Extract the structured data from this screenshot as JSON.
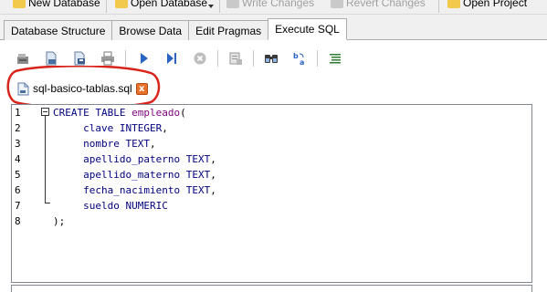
{
  "top_toolbar": {
    "items": [
      {
        "label": "New Database",
        "icon": "new-database-icon",
        "enabled": true
      },
      {
        "label": "Open Database",
        "icon": "open-database-icon",
        "enabled": true
      },
      {
        "label": "Write Changes",
        "icon": "write-changes-icon",
        "enabled": false
      },
      {
        "label": "Revert Changes",
        "icon": "revert-changes-icon",
        "enabled": false
      },
      {
        "label": "Open Project",
        "icon": "open-project-icon",
        "enabled": true
      }
    ]
  },
  "tabs": [
    {
      "label": "Database Structure",
      "active": false
    },
    {
      "label": "Browse Data",
      "active": false
    },
    {
      "label": "Edit Pragmas",
      "active": false
    },
    {
      "label": "Execute SQL",
      "active": true
    }
  ],
  "sql_toolbar": {
    "buttons": [
      "open-tab-icon",
      "open-sql-file-icon",
      "save-sql-file-icon",
      "print-icon",
      "execute-all-icon",
      "execute-line-icon",
      "stop-icon",
      "save-results-icon",
      "find-icon",
      "find-replace-icon",
      "comment-icon"
    ]
  },
  "file_tab": {
    "name": "sql-basico-tablas.sql",
    "close_label": "x"
  },
  "editor": {
    "line_numbers": [
      "1",
      "2",
      "3",
      "4",
      "5",
      "6",
      "7",
      "8"
    ],
    "lines": [
      {
        "kw": "CREATE TABLE",
        "name": " empleado",
        "rest": "("
      },
      {
        "indent": "     ",
        "id": "clave",
        "type": " INTEGER",
        "rest": ","
      },
      {
        "indent": "     ",
        "id": "nombre",
        "type": " TEXT",
        "rest": ","
      },
      {
        "indent": "     ",
        "id": "apellido_paterno",
        "type": " TEXT",
        "rest": ","
      },
      {
        "indent": "     ",
        "id": "apellido_materno",
        "type": " TEXT",
        "rest": ","
      },
      {
        "indent": "     ",
        "id": "fecha_nacimiento",
        "type": " TEXT",
        "rest": ","
      },
      {
        "indent": "     ",
        "id": "sueldo",
        "type": " NUMERIC",
        "rest": ""
      },
      {
        "rest": ");"
      }
    ]
  },
  "colors": {
    "keyword": "#00007f",
    "table_name": "#7f007f",
    "annotation": "#d9241c",
    "close_button": "#e8702a"
  }
}
